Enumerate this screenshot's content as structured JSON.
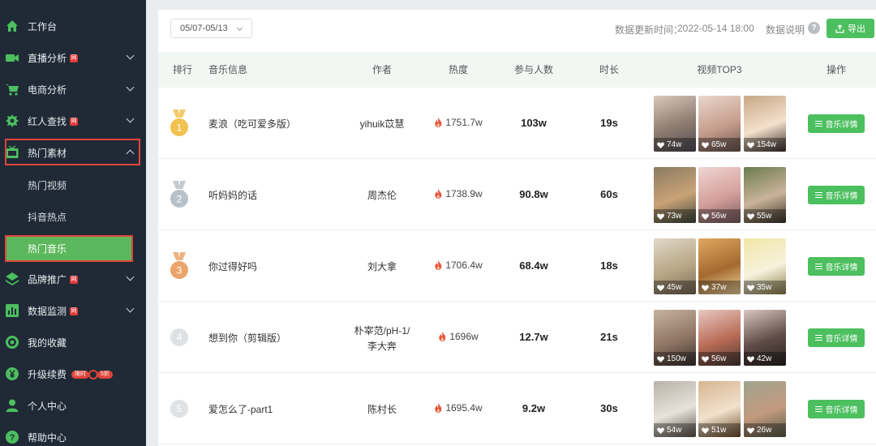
{
  "sidebar": {
    "items": [
      {
        "label": "工作台",
        "icon": "home-icon"
      },
      {
        "label": "直播分析",
        "icon": "live-camera-icon",
        "vip": true
      },
      {
        "label": "电商分析",
        "icon": "cart-icon"
      },
      {
        "label": "红人查找",
        "icon": "gear-star-icon",
        "vip": true
      },
      {
        "label": "热门素材",
        "icon": "tv-icon"
      },
      {
        "label": "品牌推广",
        "icon": "layers-icon",
        "vip": true
      },
      {
        "label": "数据监测",
        "icon": "bar-chart-icon",
        "vip": true
      },
      {
        "label": "我的收藏",
        "icon": "target-icon"
      },
      {
        "label": "升级续费",
        "icon": "yen-icon"
      },
      {
        "label": "个人中心",
        "icon": "user-icon"
      },
      {
        "label": "帮助中心",
        "icon": "help-icon"
      }
    ],
    "vip_badge": "网",
    "promo_left": "限时",
    "promo_right": "5折",
    "sub_items": [
      "热门视频",
      "抖音热点",
      "热门音乐"
    ]
  },
  "toolbar": {
    "date_range": "05/07-05/13",
    "update_label": "数据更新时间：",
    "update_value": "2022-05-14 18:00",
    "data_note": "数据说明",
    "help": "?",
    "export": "导出"
  },
  "table": {
    "headers": {
      "rank": "排行",
      "music": "音乐信息",
      "author": "作者",
      "heat": "热度",
      "participants": "参与人数",
      "duration": "时长",
      "top3": "视频TOP3",
      "action": "操作"
    },
    "detail_label": "音乐详情",
    "rows": [
      {
        "rank": "1",
        "title": "麦浪（吃可爱多版）",
        "author": "yihuik苡慧",
        "author2": "",
        "heat": "1751.7w",
        "participants": "103w",
        "duration": "19s",
        "likes": [
          "74w",
          "65w",
          "154w"
        ]
      },
      {
        "rank": "2",
        "title": "听妈妈的话",
        "author": "周杰伦",
        "author2": "",
        "heat": "1738.9w",
        "participants": "90.8w",
        "duration": "60s",
        "likes": [
          "73w",
          "56w",
          "55w"
        ]
      },
      {
        "rank": "3",
        "title": "你过得好吗",
        "author": "刘大拿",
        "author2": "",
        "heat": "1706.4w",
        "participants": "68.4w",
        "duration": "18s",
        "likes": [
          "45w",
          "37w",
          "35w"
        ]
      },
      {
        "rank": "4",
        "title": "想到你（剪辑版）",
        "author": "朴宰范/pH-1/",
        "author2": "李大奔",
        "heat": "1696w",
        "participants": "12.7w",
        "duration": "21s",
        "likes": [
          "150w",
          "56w",
          "42w"
        ]
      },
      {
        "rank": "5",
        "title": "爱怎么了-part1",
        "author": "陈村长",
        "author2": "",
        "heat": "1695.4w",
        "participants": "9.2w",
        "duration": "30s",
        "likes": [
          "54w",
          "51w",
          "26w"
        ]
      }
    ]
  },
  "colors": {
    "sidebar_bg": "#1f2a36",
    "accent_green": "#4cbf5f",
    "highlight_red": "#e0453a",
    "gold": "#f2c150",
    "silver": "#b8c0c8",
    "bronze": "#eba46a"
  }
}
